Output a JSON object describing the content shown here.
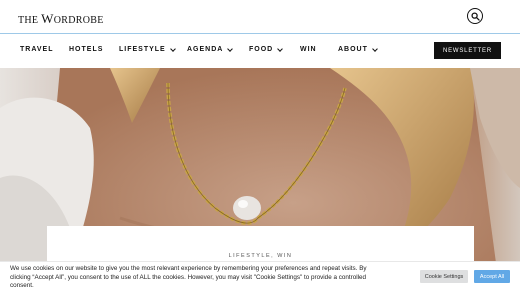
{
  "header": {
    "logo_the": "THE ",
    "logo_w": "W",
    "logo_rest": "ORDROBE",
    "search_icon": "search-icon"
  },
  "nav": {
    "items": [
      {
        "label": "TRAVEL",
        "dropdown": false
      },
      {
        "label": "HOTELS",
        "dropdown": false
      },
      {
        "label": "LIFESTYLE",
        "dropdown": true
      },
      {
        "label": "AGENDA",
        "dropdown": true
      },
      {
        "label": "FOOD",
        "dropdown": true
      },
      {
        "label": "WIN",
        "dropdown": false
      },
      {
        "label": "ABOUT",
        "dropdown": true
      }
    ],
    "newsletter_label": "NEWSLETTER"
  },
  "article": {
    "categories": "LIFESTYLE, WIN"
  },
  "cookie": {
    "text": "We use cookies on our website to give you the most relevant experience by remembering your preferences and repeat visits. By clicking “Accept All”, you consent to the use of ALL the cookies. However, you may visit \"Cookie Settings\" to provide a controlled consent.",
    "settings_label": "Cookie Settings",
    "accept_label": "Accept All"
  },
  "colors": {
    "accent_divider": "#9ec9e8",
    "accept_button": "#61a8e6",
    "newsletter_button": "#111111"
  }
}
